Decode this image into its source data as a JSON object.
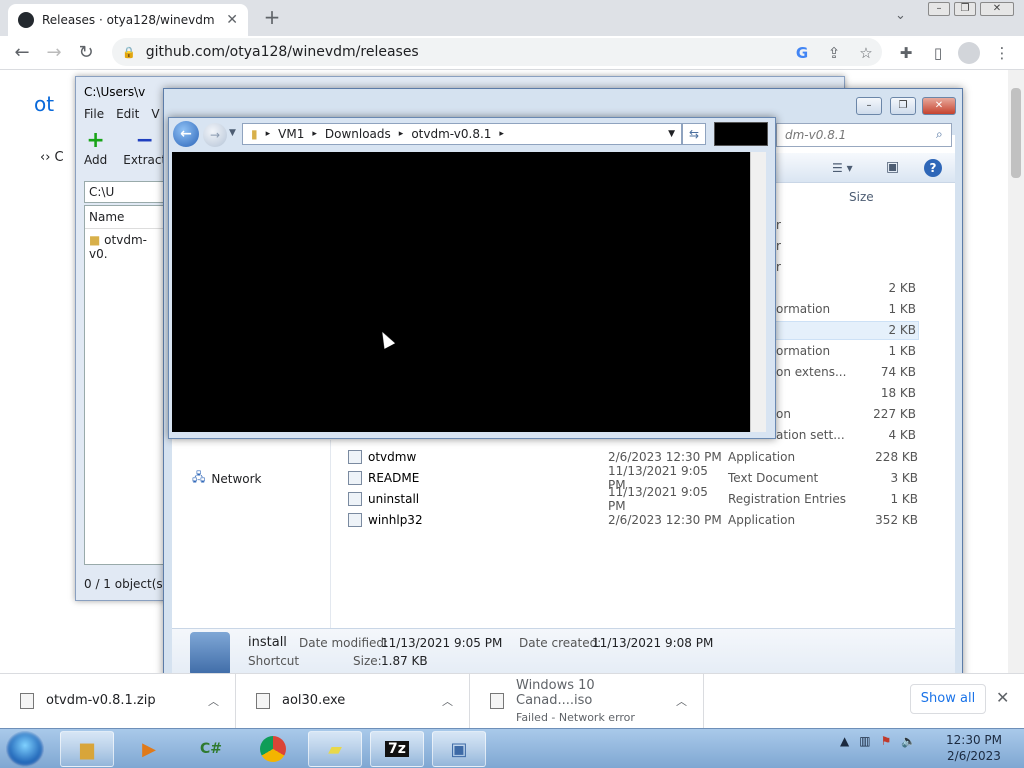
{
  "browser": {
    "tab_title": "Releases · otya128/winevdm",
    "url": "github.com/otya128/winevdm/releases",
    "page_fragments": {
      "title_fragment": "ot",
      "code_tab": "C"
    }
  },
  "zip_window": {
    "title": "C:\\Users\\v",
    "menu": [
      "File",
      "Edit",
      "V"
    ],
    "tools": [
      {
        "label": "Add",
        "icon": "+"
      },
      {
        "label": "Extract",
        "icon": "−"
      }
    ],
    "path": "C:\\U",
    "column": "Name",
    "item": "otvdm-v0.",
    "status": "0 / 1 object(s) s"
  },
  "explorer": {
    "search_placeholder": "dm-v0.8.1",
    "column_size": "Size",
    "partial_rows": [
      {
        "type": "r",
        "size": ""
      },
      {
        "type": "r",
        "size": ""
      },
      {
        "type": "r",
        "size": ""
      },
      {
        "type": "",
        "size": "2 KB"
      },
      {
        "type": "ormation",
        "size": "1 KB"
      },
      {
        "type": "",
        "size": "2 KB"
      },
      {
        "type": "ormation",
        "size": "1 KB"
      },
      {
        "type": "on extens...",
        "size": "74 KB"
      },
      {
        "type": "",
        "size": "18 KB"
      },
      {
        "type": "on",
        "size": "227 KB"
      },
      {
        "type": "ation sett...",
        "size": "4 KB"
      }
    ],
    "rows": [
      {
        "name": "otvdmw",
        "date": "2/6/2023 12:30 PM",
        "type": "Application",
        "size": "228 KB"
      },
      {
        "name": "README",
        "date": "11/13/2021 9:05 PM",
        "type": "Text Document",
        "size": "3 KB"
      },
      {
        "name": "uninstall",
        "date": "11/13/2021 9:05 PM",
        "type": "Registration Entries",
        "size": "1 KB"
      },
      {
        "name": "winhlp32",
        "date": "2/6/2023 12:30 PM",
        "type": "Application",
        "size": "352 KB"
      }
    ],
    "nav_network": "Network",
    "details": {
      "name": "install",
      "kind": "Shortcut",
      "modified_label": "Date modified:",
      "modified_value": "11/13/2021 9:05 PM",
      "created_label": "Date created:",
      "created_value": "11/13/2021 9:08 PM",
      "size_label": "Size:",
      "size_value": "1.87 KB"
    }
  },
  "popup": {
    "breadcrumb": [
      "VM1",
      "Downloads",
      "otvdm-v0.8.1"
    ]
  },
  "downloads": [
    {
      "name": "otvdm-v0.8.1.zip",
      "status": ""
    },
    {
      "name": "aol30.exe",
      "status": ""
    },
    {
      "name": "Windows 10 Canad....iso",
      "status": "Failed - Network error"
    }
  ],
  "downloads_show_all": "Show all",
  "taskbar": {
    "buttons": [
      "explorer",
      "media",
      "csharp",
      "chrome",
      "notes",
      "7zip",
      "installer"
    ],
    "time": "12:30 PM",
    "date": "2/6/2023"
  }
}
